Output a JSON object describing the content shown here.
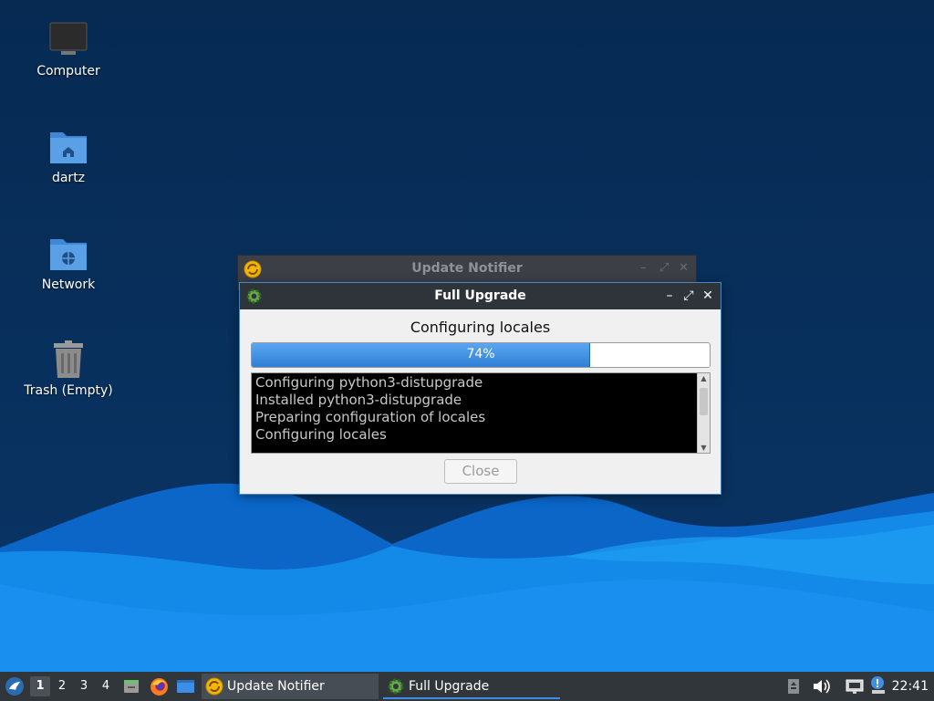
{
  "desktop": {
    "icons": [
      {
        "label": "Computer",
        "icon": "computer-icon"
      },
      {
        "label": "dartz",
        "icon": "home-folder-icon"
      },
      {
        "label": "Network",
        "icon": "network-folder-icon"
      },
      {
        "label": "Trash (Empty)",
        "icon": "trash-icon"
      }
    ]
  },
  "notifier_window": {
    "title": "Update Notifier"
  },
  "upgrade_window": {
    "title": "Full Upgrade",
    "status": "Configuring locales",
    "progress_percent": 74,
    "progress_label": "74%",
    "log_lines": [
      "Configuring python3-distupgrade",
      "Installed python3-distupgrade",
      "Preparing configuration of locales",
      "Configuring locales"
    ],
    "close_label": "Close"
  },
  "taskbar": {
    "workspaces": [
      "1",
      "2",
      "3",
      "4"
    ],
    "active_workspace": "1",
    "tasks": [
      {
        "label": "Update Notifier"
      },
      {
        "label": "Full Upgrade"
      }
    ],
    "clock": "22:41"
  },
  "colors": {
    "desktop_bg": "#0a3566",
    "accent": "#3d8ee6",
    "progress_fill": "#2f7fd6",
    "titlebar": "#2f343a"
  }
}
